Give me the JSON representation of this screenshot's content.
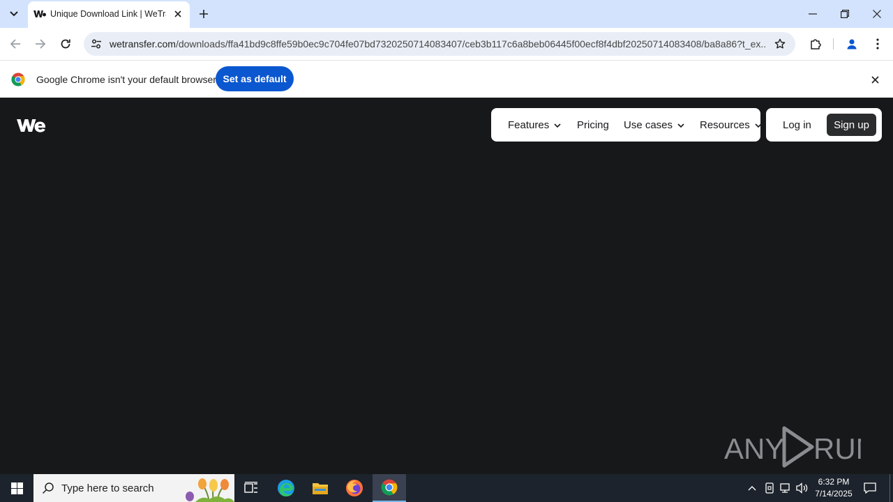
{
  "browser": {
    "tab": {
      "title": "Unique Download Link | WeTransfer"
    },
    "url": {
      "host": "wetransfer.com",
      "path": "/downloads/ffa41bd9c8ffe59b0ec9c704fe07bd7320250714083407/ceb3b117c6a8beb06445f00ecf8f4dbf20250714083408/ba8a86?t_ex..."
    },
    "infobar": {
      "message": "Google Chrome isn't your default browser",
      "button": "Set as default"
    }
  },
  "site": {
    "nav": {
      "features": "Features",
      "pricing": "Pricing",
      "use_cases": "Use cases",
      "resources": "Resources"
    },
    "auth": {
      "login": "Log in",
      "signup": "Sign up"
    }
  },
  "watermark": {
    "left": "ANY",
    "right": "RUN"
  },
  "taskbar": {
    "search_placeholder": "Type here to search",
    "time": "6:32 PM",
    "date": "7/14/2025"
  },
  "colors": {
    "page_bg": "#17181a",
    "tabstrip_bg": "#d3e3fd",
    "accent_blue": "#0b57d0",
    "signup_bg": "#2b2c2e"
  }
}
